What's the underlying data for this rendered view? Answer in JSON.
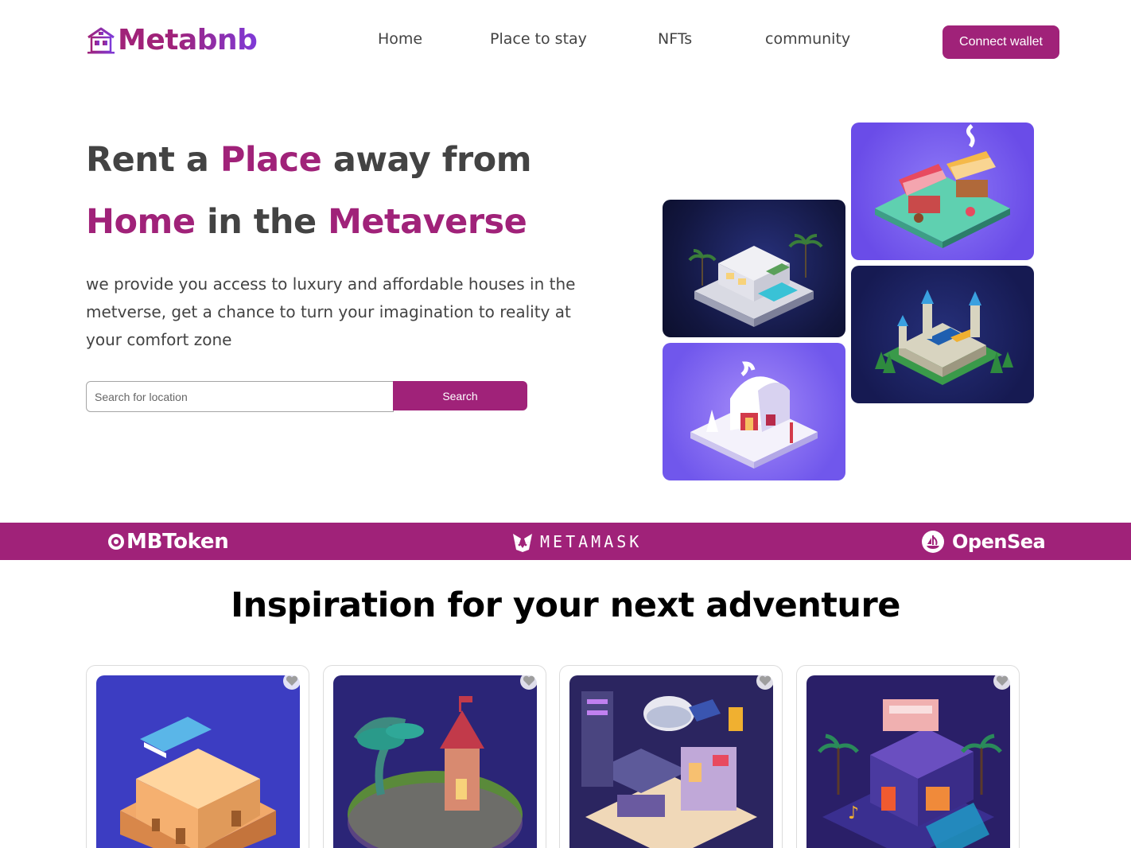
{
  "brand": {
    "name": "Metabnb",
    "gradient_start": "#a02279",
    "gradient_end": "#7e3ad8"
  },
  "nav": {
    "links": [
      "Home",
      "Place to stay",
      "NFTs",
      "community"
    ],
    "connect_label": "Connect wallet"
  },
  "hero": {
    "line1_a": "Rent a ",
    "line1_b": "Place",
    "line1_c": " away from",
    "line2_a": "Home",
    "line2_b": " in the ",
    "line2_c": "Metaverse",
    "description": "we provide you access to luxury and affordable houses in the metverse, get a chance to turn your imagination to reality at your comfort zone",
    "search_placeholder": "Search for location",
    "search_label": "Search"
  },
  "gallery": {
    "tiles": [
      "villa-pool-icon",
      "market-stall-icon",
      "castle-icon",
      "snow-house-icon"
    ]
  },
  "partners": [
    "MBToken",
    "METAMASK",
    "OpenSea"
  ],
  "inspiration": {
    "title": "Inspiration for your next adventure",
    "cards": [
      "desert-house",
      "tree-tower",
      "futuristic-base",
      "neon-house"
    ]
  },
  "colors": {
    "accent": "#a02279",
    "text": "#434343"
  }
}
